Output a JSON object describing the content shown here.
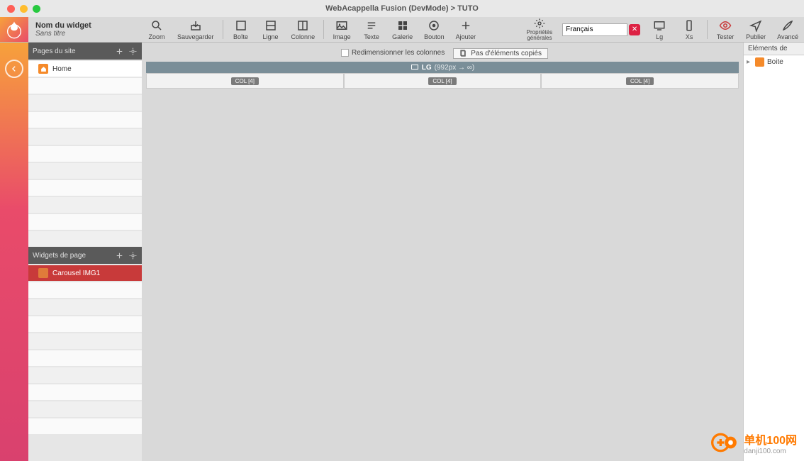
{
  "window": {
    "title": "WebAcappella Fusion (DevMode) > TUTO"
  },
  "widget_info": {
    "label": "Nom du widget",
    "value": "Sans titre"
  },
  "toolbar": {
    "zoom": "Zoom",
    "save": "Sauvegarder",
    "box": "Boîte",
    "line": "Ligne",
    "column": "Colonne",
    "image": "Image",
    "text": "Texte",
    "gallery": "Galerie",
    "button": "Bouton",
    "add": "Ajouter",
    "props1": "Propriétés",
    "props2": "générales",
    "lg": "Lg",
    "xs": "Xs",
    "test": "Tester",
    "publish": "Publier",
    "advanced": "Avancé"
  },
  "language": "Français",
  "sidebar": {
    "pages_title": "Pages du site",
    "pages": [
      {
        "label": "Home"
      }
    ],
    "widgets_title": "Widgets de page",
    "widgets": [
      {
        "label": "Carousel IMG1"
      }
    ]
  },
  "canvas": {
    "resize_label": "Redimensionner les colonnes",
    "none_copied": "Pas d'éléments copiés",
    "breakpoint_name": "LG",
    "breakpoint_range": "(992px → ∞)",
    "col_label": "COL [4]"
  },
  "rightpanel": {
    "title": "Eléments de",
    "root": "Boite"
  },
  "watermark": {
    "name": "单机100网",
    "url": "danji100.com"
  }
}
